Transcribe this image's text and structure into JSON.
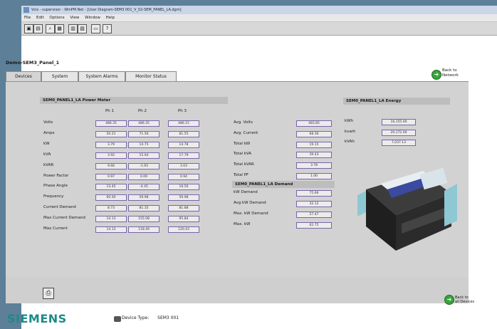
{
  "window": {
    "title": "Vcis - supervisor - WinPM.Net - [User Diagram-SEM3 001_V_02-SEM_PANEL_LA.dgm]",
    "menu": [
      "File",
      "Edit",
      "Options",
      "View",
      "Window",
      "Help"
    ],
    "toolbar": [
      "print-icon",
      "save-icon",
      "zoom-icon",
      "grid-icon",
      "table-icon",
      "chart-icon",
      "window-icon",
      "help-icon"
    ]
  },
  "page": {
    "device_title": "Demo-SEM3_Panel_1",
    "tabs": [
      "Devices",
      "System",
      "System Alarms",
      "Monitor Status"
    ],
    "back_network": [
      "Back to",
      "Network"
    ],
    "back_devices": [
      "Back to",
      "all Devices"
    ]
  },
  "power_meter": {
    "header": "SEM0_PANEL1_LA Power Meter",
    "columns": [
      "Ph 1",
      "Ph 2",
      "Ph 3"
    ],
    "rows": [
      {
        "label": "Volts",
        "values": [
          "486.35",
          "486.35",
          "486.15"
        ]
      },
      {
        "label": "Amps",
        "values": [
          "50.21",
          "71.56",
          "81.55"
        ]
      },
      {
        "label": "kW",
        "values": [
          "3.79",
          "14.75",
          "14.78"
        ]
      },
      {
        "label": "kVA",
        "values": [
          "3.92",
          "15.04",
          "17.79"
        ]
      },
      {
        "label": "kVAR",
        "values": [
          "9.66",
          "-1.93",
          "3.03"
        ]
      },
      {
        "label": "Power Factor",
        "values": [
          "0.97",
          "0.09",
          "0.94"
        ]
      },
      {
        "label": "Phase Angle",
        "values": [
          "13.45",
          "-4.45",
          "19.56"
        ]
      },
      {
        "label": "Frequency",
        "values": [
          "60.00",
          "59.98",
          "59.98"
        ]
      },
      {
        "label": "Current Demand",
        "values": [
          "8.73",
          "81.35",
          "81.88"
        ]
      },
      {
        "label": "Max Current Demand",
        "values": [
          "14.13",
          "155.08",
          "95.84"
        ]
      },
      {
        "label": "Max Current",
        "values": [
          "14.13",
          "118.49",
          "120.43"
        ]
      }
    ]
  },
  "totals": {
    "rows": [
      {
        "label": "Avg. Volts",
        "value": "483.85"
      },
      {
        "label": "Avg. Current",
        "value": "68.36"
      },
      {
        "label": "Total kW",
        "value": "19.15"
      },
      {
        "label": "Total kVA",
        "value": "39.43"
      },
      {
        "label": "Total kVAR",
        "value": "3.78"
      },
      {
        "label": "Total PF",
        "value": "1.00"
      }
    ]
  },
  "demand": {
    "header": "SEM0_PANEL1_LA Demand",
    "rows": [
      {
        "label": "kW Demand",
        "value": "75.66"
      },
      {
        "label": "Avg kW Demand",
        "value": "32.12"
      },
      {
        "label": "Max. kW Demand",
        "value": "57.47"
      },
      {
        "label": "Max. kW",
        "value": "62.75"
      }
    ]
  },
  "energy": {
    "header": "SEM0_PANEL1_LA Energy",
    "rows": [
      {
        "label": "kWh",
        "value": "16,155.00"
      },
      {
        "label": "kvarh",
        "value": "20,172.00"
      },
      {
        "label": "kVAh",
        "value": "7,037.13"
      }
    ]
  },
  "footer": {
    "brand": "SIEMENS",
    "device_type_label": "Device Type:",
    "device_type_value": "SEM3 001"
  },
  "colors": {
    "background": "#5d7f98",
    "panel": "#d2d2d2",
    "value_border": "#7a64a8",
    "brand": "#1b8a8a",
    "nav_button": "#39a33d"
  }
}
